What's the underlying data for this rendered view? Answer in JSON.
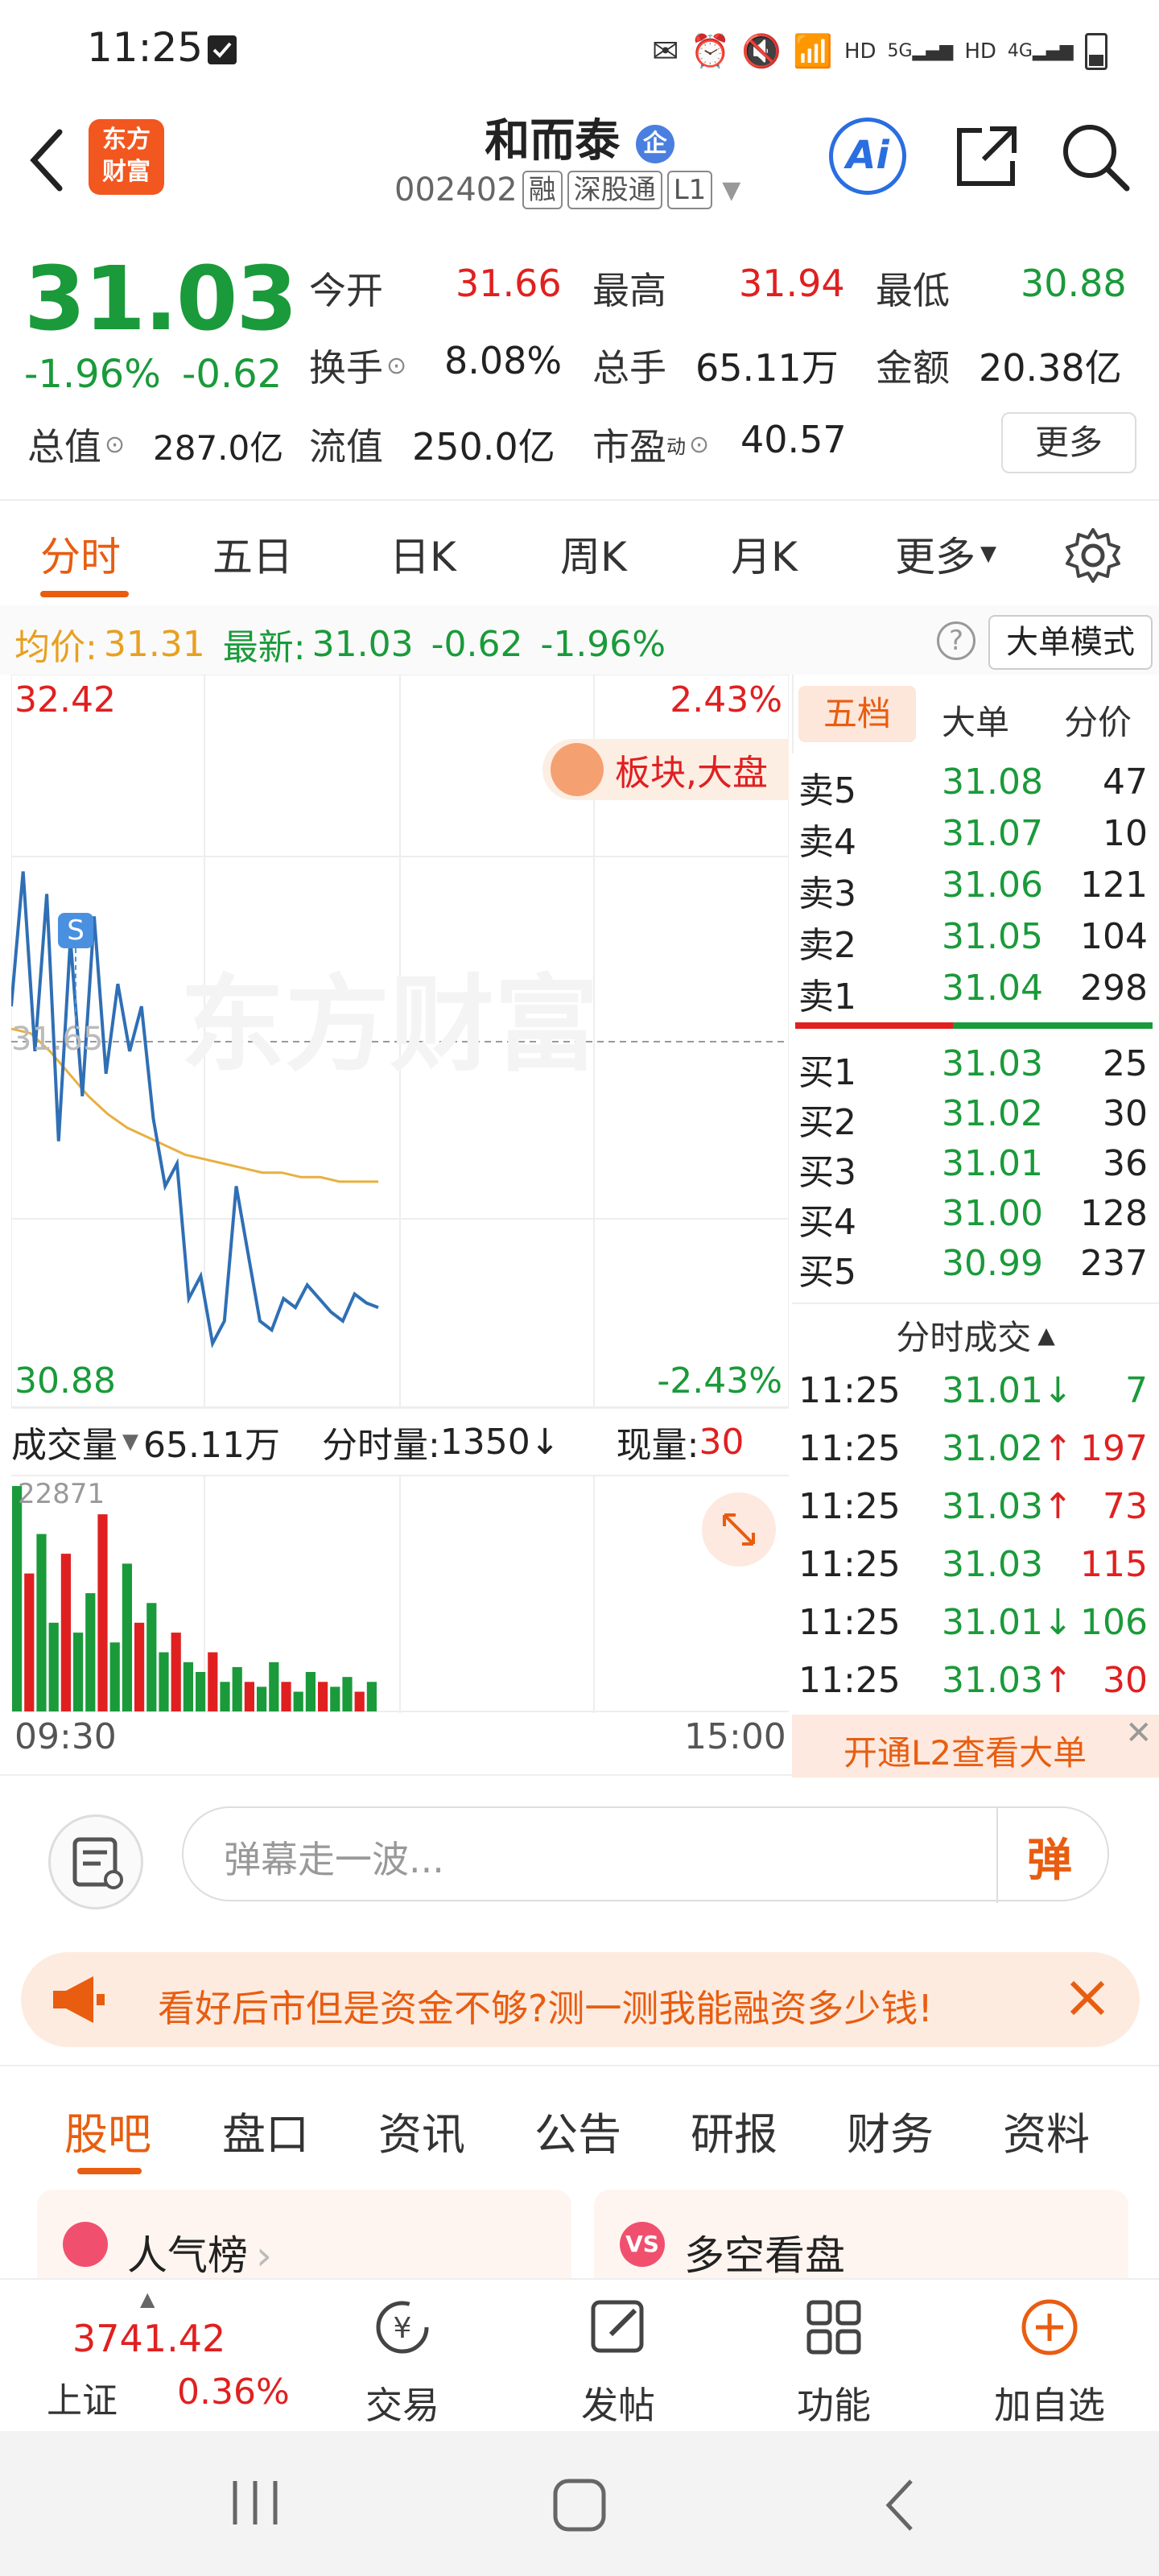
{
  "status_bar": {
    "time": "11:25",
    "net_labels": [
      "HD",
      "5G",
      "HD",
      "4G"
    ]
  },
  "header": {
    "stock_name": "和而泰",
    "badge": "企",
    "code": "002402",
    "tags": [
      "融",
      "深股通",
      "L1"
    ],
    "logo_line1": "东方",
    "logo_line2": "财富",
    "ai_label": "Ai"
  },
  "quote": {
    "last": "31.03",
    "pct": "-1.96%",
    "change": "-0.62",
    "open_label": "今开",
    "open": "31.66",
    "high_label": "最高",
    "high": "31.94",
    "low_label": "最低",
    "low": "30.88",
    "turnover_label": "换手",
    "turnover": "8.08%",
    "volume_label": "总手",
    "volume": "65.11万",
    "amount_label": "金额",
    "amount": "20.38亿",
    "mktcap_label": "总值",
    "mktcap": "287.0亿",
    "float_label": "流值",
    "float": "250.0亿",
    "pe_label": "市盈",
    "pe_sup": "动",
    "pe": "40.57",
    "more": "更多"
  },
  "chart_tabs": [
    "分时",
    "五日",
    "日K",
    "周K",
    "月K",
    "更多"
  ],
  "price_line": {
    "avg_label": "均价:",
    "avg": "31.31",
    "latest_label": "最新:",
    "latest": "31.03",
    "chg": "-0.62",
    "pct": "-1.96%",
    "mode_btn": "大单模式"
  },
  "chart": {
    "y_top": "32.42",
    "y_bottom": "30.88",
    "pct_top": "2.43%",
    "pct_bottom": "-2.43%",
    "mid_label": "31.65",
    "s_marker": "S",
    "watermark": "东方财富",
    "bubble_text": "板块,大盘",
    "vol_label": "成交量",
    "vol_total": "65.11万",
    "minute_vol_label": "分时量:",
    "minute_vol": "1350",
    "now_vol_label": "现量:",
    "now_vol": "30",
    "vol_max": "22871",
    "time_start": "09:30",
    "time_end": "15:00"
  },
  "chart_data": {
    "type": "line",
    "title": "",
    "xlabel": "",
    "ylabel": "",
    "ylim": [
      30.88,
      32.42
    ],
    "x": [
      "09:30",
      "15:00"
    ],
    "series": [
      {
        "name": "",
        "values": [
          31.7,
          32.0,
          31.6,
          31.95,
          31.4,
          31.85,
          31.5,
          31.9,
          31.55,
          31.75,
          31.6,
          31.7,
          31.45,
          31.3,
          31.35,
          31.05,
          31.1,
          30.95,
          31.0,
          31.3,
          31.15,
          31.0,
          30.98,
          31.05,
          31.03,
          31.08,
          31.05,
          31.02,
          31.0,
          31.06,
          31.04,
          31.03
        ]
      },
      {
        "name": "",
        "values": [
          31.65,
          31.64,
          31.6,
          31.55,
          31.5,
          31.46,
          31.43,
          31.41,
          31.39,
          31.37,
          31.36,
          31.35,
          31.34,
          31.33,
          31.33,
          31.32,
          31.32,
          31.31,
          31.31,
          31.31
        ]
      }
    ],
    "volume_values": [
      22871,
      14000,
      18000,
      9000,
      16000,
      8000,
      12000,
      20000,
      7000,
      15000,
      9000,
      11000,
      6000,
      8000,
      5000,
      4000,
      6000,
      3000,
      4500,
      3000,
      2500,
      5000,
      3000,
      2000,
      4000,
      3000,
      2500,
      3500,
      2000,
      3000
    ]
  },
  "orderbook": {
    "tabs": [
      "五档",
      "大单",
      "分价"
    ],
    "asks": [
      {
        "label": "卖5",
        "price": "31.08",
        "qty": "47"
      },
      {
        "label": "卖4",
        "price": "31.07",
        "qty": "10"
      },
      {
        "label": "卖3",
        "price": "31.06",
        "qty": "121"
      },
      {
        "label": "卖2",
        "price": "31.05",
        "qty": "104"
      },
      {
        "label": "卖1",
        "price": "31.04",
        "qty": "298"
      }
    ],
    "bids": [
      {
        "label": "买1",
        "price": "31.03",
        "qty": "25"
      },
      {
        "label": "买2",
        "price": "31.02",
        "qty": "30"
      },
      {
        "label": "买3",
        "price": "31.01",
        "qty": "36"
      },
      {
        "label": "买4",
        "price": "31.00",
        "qty": "128"
      },
      {
        "label": "买5",
        "price": "30.99",
        "qty": "237"
      }
    ],
    "ticks_title": "分时成交",
    "ticks": [
      {
        "time": "11:25",
        "price": "31.01",
        "dir": "↓",
        "qty": "7"
      },
      {
        "time": "11:25",
        "price": "31.02",
        "dir": "↑",
        "qty": "197"
      },
      {
        "time": "11:25",
        "price": "31.03",
        "dir": "↑",
        "qty": "73"
      },
      {
        "time": "11:25",
        "price": "31.03",
        "dir": "",
        "qty": "115"
      },
      {
        "time": "11:25",
        "price": "31.01",
        "dir": "↓",
        "qty": "106"
      },
      {
        "time": "11:25",
        "price": "31.03",
        "dir": "↑",
        "qty": "30"
      }
    ],
    "l2_promo": "开通L2查看大单"
  },
  "comment": {
    "placeholder": "弹幕走一波...",
    "danmu_btn": "弹"
  },
  "ad": {
    "text": "看好后市但是资金不够?测一测我能融资多少钱!"
  },
  "bottom_tabs": [
    "股吧",
    "盘口",
    "资讯",
    "公告",
    "研报",
    "财务",
    "资料"
  ],
  "cards": [
    {
      "icon": "",
      "title": "人气榜"
    },
    {
      "icon": "VS",
      "title": "多空看盘"
    }
  ],
  "bottom_nav": {
    "index_value": "3741.42",
    "index_name": "上证",
    "index_pct": "0.36%",
    "items": [
      "交易",
      "发帖",
      "功能",
      "加自选"
    ]
  },
  "colors": {
    "up": "#e02020",
    "down": "#1a9a3a",
    "accent": "#e85d10",
    "avg_line": "#e8b040",
    "price_line": "#2f6fb5"
  }
}
